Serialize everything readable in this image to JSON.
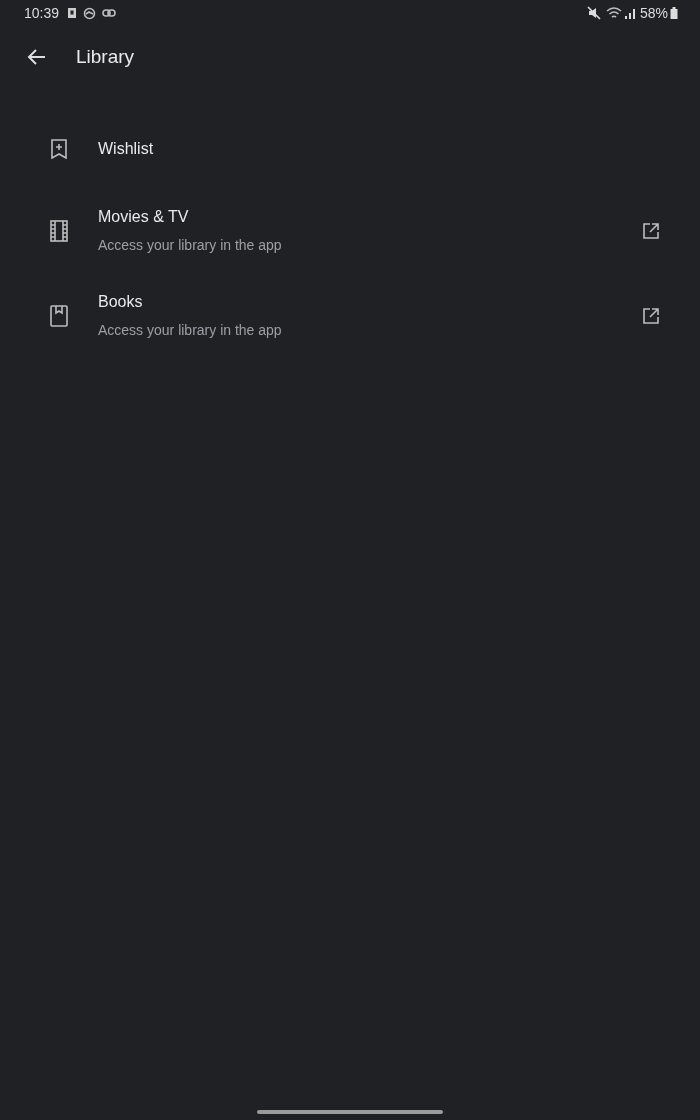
{
  "status_bar": {
    "time": "10:39",
    "battery": "58%"
  },
  "app_bar": {
    "title": "Library"
  },
  "items": [
    {
      "title": "Wishlist",
      "external": false
    },
    {
      "title": "Movies & TV",
      "subtitle": "Access your library in the app",
      "external": true
    },
    {
      "title": "Books",
      "subtitle": "Access your library in the app",
      "external": true
    }
  ]
}
